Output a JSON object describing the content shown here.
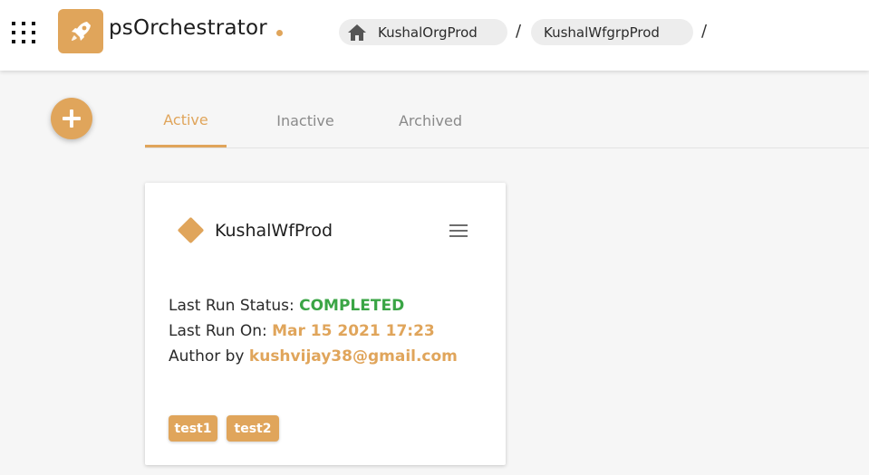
{
  "header": {
    "brand_name": "psOrchestrator",
    "breadcrumb": [
      {
        "label": "KushalOrgProd",
        "icon": "home-icon"
      },
      {
        "label": "KushalWfgrpProd"
      }
    ],
    "separator": "/"
  },
  "tabs": [
    {
      "label": "Active",
      "selected": true
    },
    {
      "label": "Inactive",
      "selected": false
    },
    {
      "label": "Archived",
      "selected": false
    }
  ],
  "workflow_card": {
    "title": "KushalWfProd",
    "status_label": "Last Run Status:",
    "status_value": "COMPLETED",
    "run_on_label": "Last Run On:",
    "run_on_value": "Mar 15 2021 17:23",
    "author_label": "Author by",
    "author_value": "kushvijay38@gmail.com",
    "tags": [
      "test1",
      "test2"
    ]
  },
  "colors": {
    "accent": "#e0a55b",
    "status_completed": "#3aa545"
  }
}
